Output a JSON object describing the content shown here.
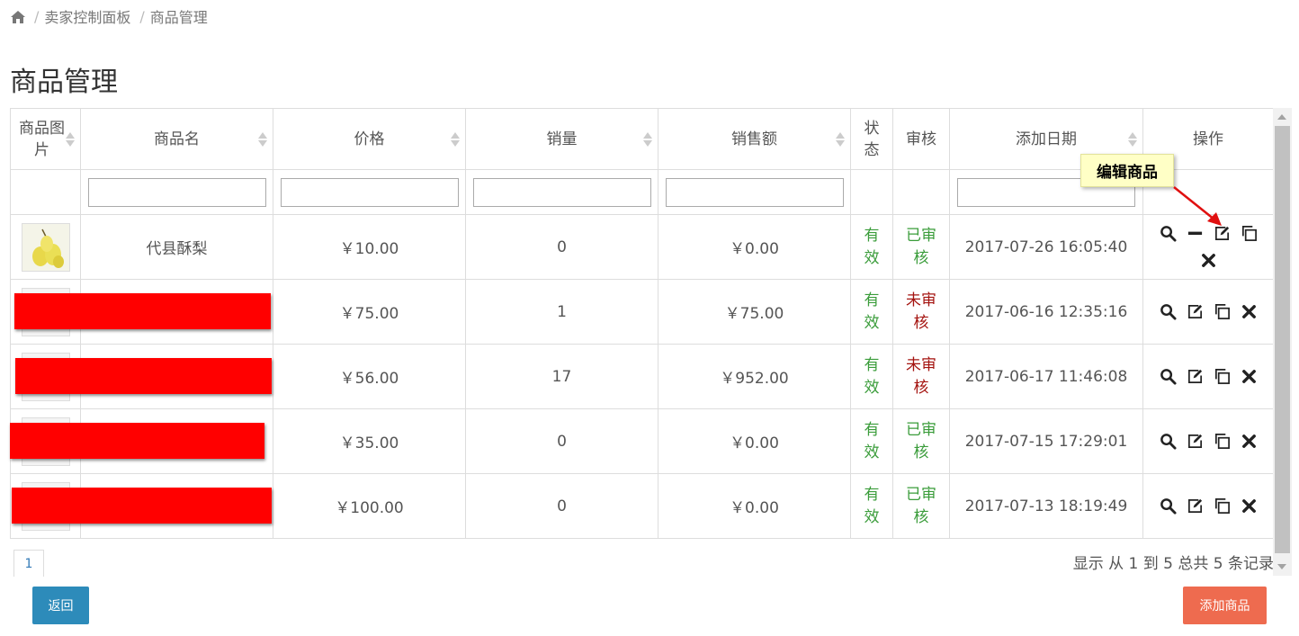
{
  "breadcrumb": {
    "items": [
      "卖家控制面板",
      "商品管理"
    ]
  },
  "page_title": "商品管理",
  "table": {
    "headers": {
      "image": "商品图片",
      "name": "商品名",
      "price": "价格",
      "sales": "销量",
      "revenue": "销售额",
      "status": "状态",
      "review": "审核",
      "date": "添加日期",
      "actions": "操作"
    },
    "rows": [
      {
        "name": "代县酥梨",
        "price": "￥10.00",
        "sales": "0",
        "revenue": "￥0.00",
        "status": "有效",
        "review": "已审核",
        "review_color": "#3a9c3a",
        "date": "2017-07-26 16:05:40",
        "action_icons": [
          "search-icon",
          "minus-icon",
          "edit-icon",
          "copy-icon",
          "close-icon"
        ]
      },
      {
        "name": "",
        "price": "￥75.00",
        "sales": "1",
        "revenue": "￥75.00",
        "status": "有效",
        "review": "未审核",
        "review_color": "#a4130f",
        "date": "2017-06-16 12:35:16",
        "action_icons": [
          "search-icon",
          "edit-icon",
          "copy-icon",
          "close-icon"
        ]
      },
      {
        "name": "",
        "price": "￥56.00",
        "sales": "17",
        "revenue": "￥952.00",
        "status": "有效",
        "review": "未审核",
        "review_color": "#a4130f",
        "date": "2017-06-17 11:46:08",
        "action_icons": [
          "search-icon",
          "edit-icon",
          "copy-icon",
          "close-icon"
        ]
      },
      {
        "name": "",
        "price": "￥35.00",
        "sales": "0",
        "revenue": "￥0.00",
        "status": "有效",
        "review": "已审核",
        "review_color": "#3a9c3a",
        "date": "2017-07-15 17:29:01",
        "action_icons": [
          "search-icon",
          "edit-icon",
          "copy-icon",
          "close-icon"
        ]
      },
      {
        "name": "",
        "price": "￥100.00",
        "sales": "0",
        "revenue": "￥0.00",
        "status": "有效",
        "review": "已审核",
        "review_color": "#3a9c3a",
        "date": "2017-07-13 18:19:49",
        "action_icons": [
          "search-icon",
          "edit-icon",
          "copy-icon",
          "close-icon"
        ]
      }
    ]
  },
  "pagination": {
    "current_page": "1",
    "summary": "显示 从 1 到 5 总共 5 条记录"
  },
  "buttons": {
    "back": "返回",
    "add": "添加商品"
  },
  "callout": "编辑商品",
  "colors": {
    "status_green": "#3a9c3a",
    "unreviewed_red": "#a4130f",
    "back_button": "#2d8bba",
    "add_button": "#ee6b4f",
    "redaction": "#ff0000"
  }
}
